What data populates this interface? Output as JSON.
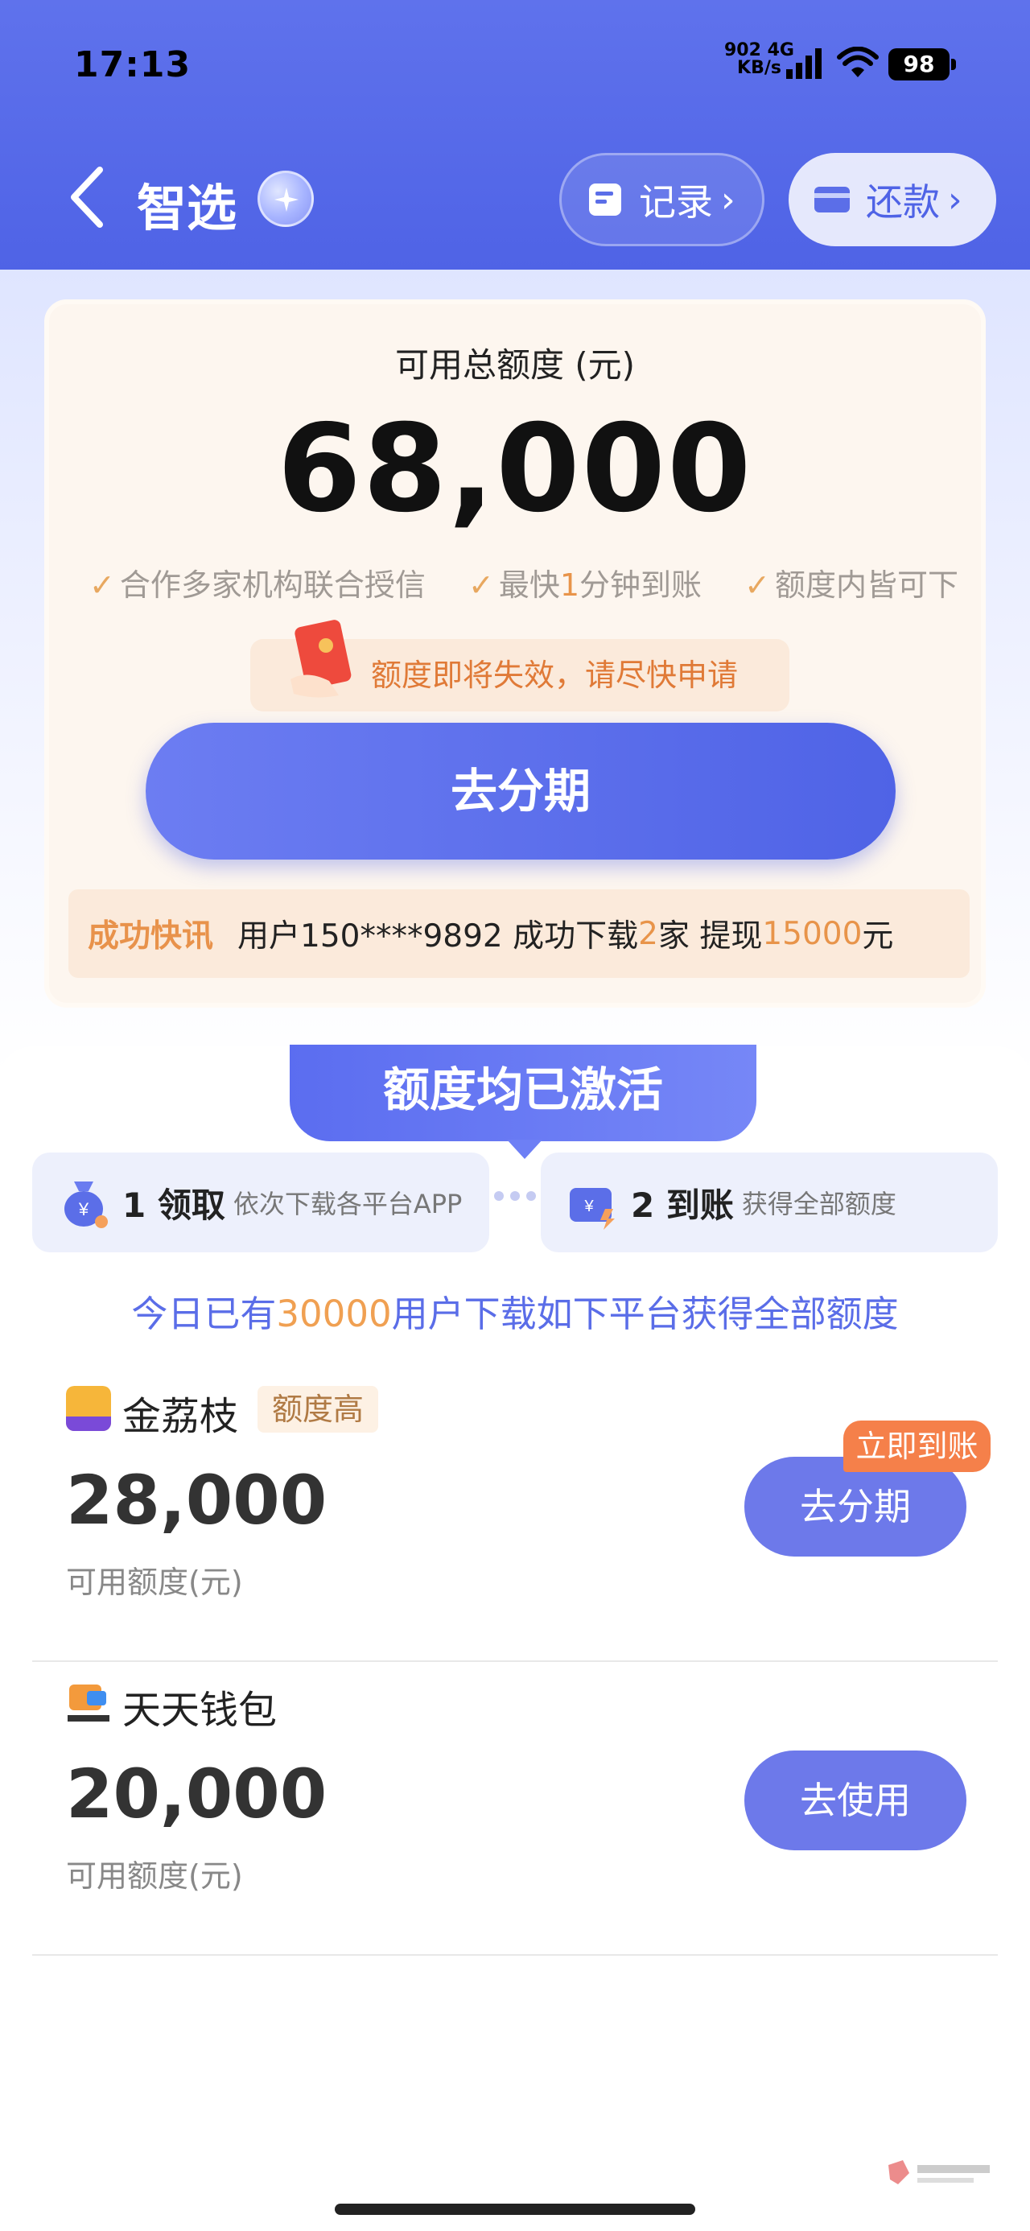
{
  "status_bar": {
    "time": "17:13",
    "net_speed": "902",
    "net_unit": "KB/s",
    "net_type": "4G",
    "battery": "98"
  },
  "header": {
    "title": "智选",
    "record_label": "记录",
    "repay_label": "还款"
  },
  "credit_card": {
    "label": "可用总额度 (元)",
    "amount": "68,000",
    "features": [
      {
        "pre": "合作多家机构联合授信",
        "hl": "",
        "post": ""
      },
      {
        "pre": "最快",
        "hl": "1",
        "post": "分钟到账"
      },
      {
        "pre": "额度内皆可下",
        "hl": "",
        "post": ""
      }
    ],
    "tip": "额度即将失效，请尽快申请",
    "cta_label": "去分期",
    "news": {
      "label": "成功快讯",
      "text1": "用户150****9892 成功下载",
      "n1": "2",
      "text2": "家 提现",
      "n2": "15000",
      "text3": "元"
    }
  },
  "activated": {
    "banner": "额度均已激活",
    "steps": [
      {
        "num": "1 领取",
        "sub": "依次下载各平台APP"
      },
      {
        "num": "2 到账",
        "sub": "获得全部额度"
      }
    ],
    "headline": {
      "pre": "今日已有",
      "num": "30000",
      "post": "用户下载如下平台获得全部额度"
    }
  },
  "platforms": [
    {
      "name": "金荔枝",
      "tag": "额度高",
      "amount": "28,000",
      "sub": "可用额度(元)",
      "button": "去分期",
      "badge": "立即到账"
    },
    {
      "name": "天天钱包",
      "tag": "",
      "amount": "20,000",
      "sub": "可用额度(元)",
      "button": "去使用",
      "badge": ""
    }
  ],
  "colors": {
    "brand": "#4f63e6",
    "orange": "#e8944a",
    "badge": "#f5804a"
  }
}
